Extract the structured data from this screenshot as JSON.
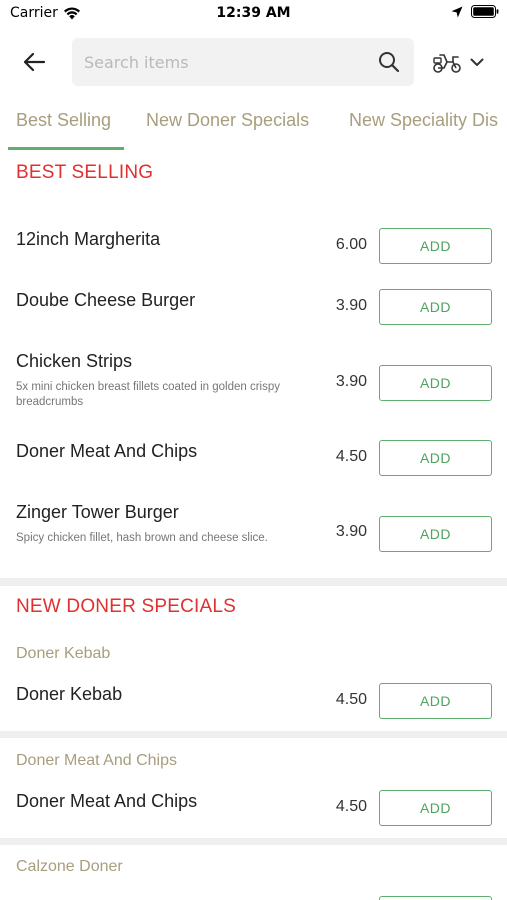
{
  "status": {
    "carrier": "Carrier",
    "time": "12:39 AM"
  },
  "search": {
    "placeholder": "Search items"
  },
  "tabs": [
    {
      "label": "Best Selling"
    },
    {
      "label": "New Doner Specials"
    },
    {
      "label": "New Speciality Dis"
    }
  ],
  "sections": {
    "best_selling": {
      "title": "BEST SELLING",
      "items": [
        {
          "name": "12inch Margherita",
          "desc": "",
          "price": "6.00",
          "button": "ADD"
        },
        {
          "name": "Doube Cheese Burger",
          "desc": "",
          "price": "3.90",
          "button": "ADD"
        },
        {
          "name": "Chicken Strips",
          "desc": "5x mini chicken breast fillets coated in golden crispy breadcrumbs",
          "price": "3.90",
          "button": "ADD"
        },
        {
          "name": "Doner Meat And Chips",
          "desc": "",
          "price": "4.50",
          "button": "ADD"
        },
        {
          "name": "Zinger Tower Burger",
          "desc": "Spicy chicken fillet, hash brown and cheese slice.",
          "price": "3.90",
          "button": "ADD"
        }
      ]
    },
    "new_doner": {
      "title": "NEW DONER SPECIALS",
      "groups": [
        {
          "subtitle": "Doner Kebab",
          "item": {
            "name": "Doner Kebab",
            "price": "4.50",
            "button": "ADD"
          }
        },
        {
          "subtitle": "Doner Meat And Chips",
          "item": {
            "name": "Doner Meat And Chips",
            "price": "4.50",
            "button": "ADD"
          }
        },
        {
          "subtitle": "Calzone Doner"
        }
      ]
    }
  },
  "colors": {
    "accent": "#5fae6e",
    "section_title": "#e03030",
    "subtle": "#a79e7d"
  },
  "icons": {
    "back": "arrow-left-icon",
    "search": "search-icon",
    "delivery": "scooter-icon",
    "dropdown": "chevron-down-icon"
  }
}
